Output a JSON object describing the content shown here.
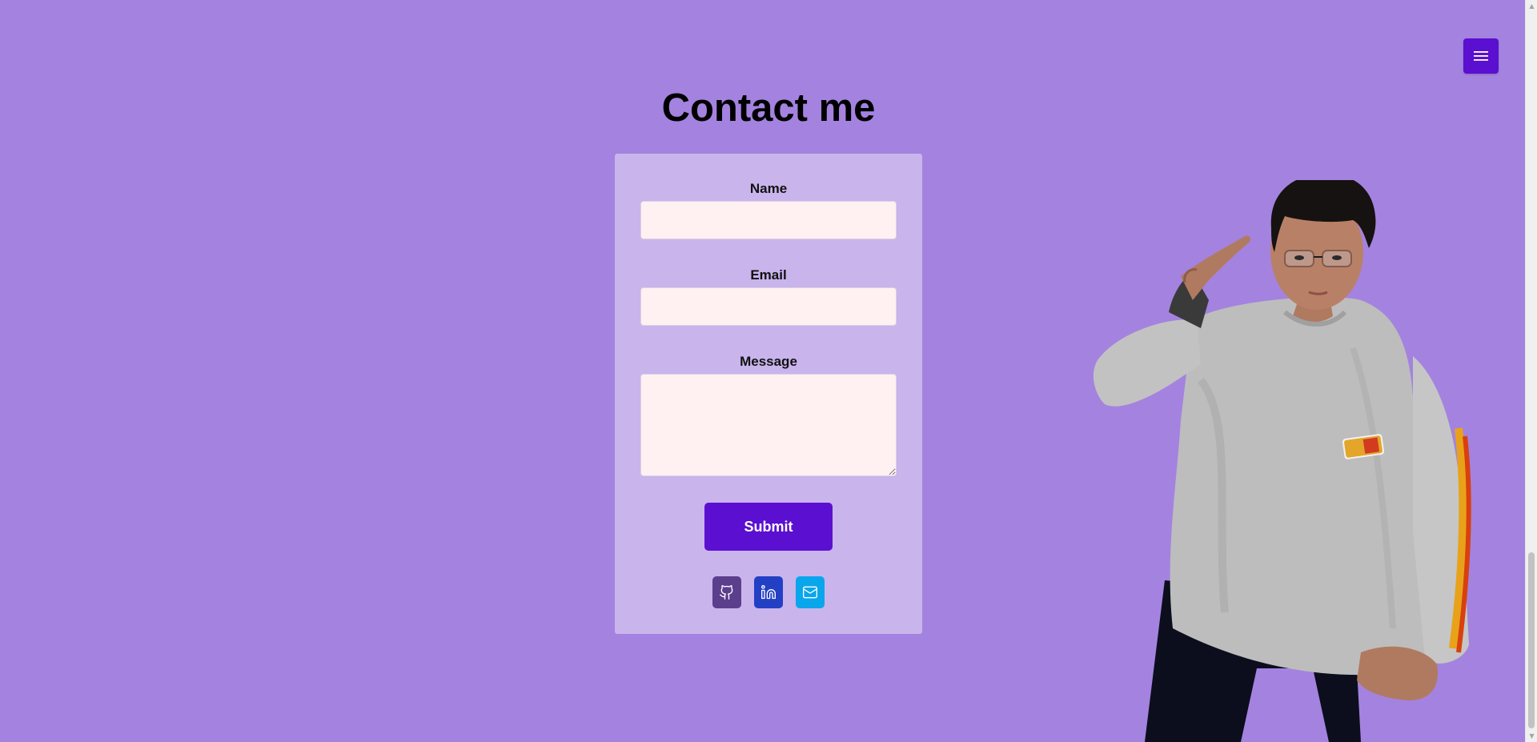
{
  "header": {
    "menu_icon": "hamburger-menu-icon"
  },
  "contact": {
    "title": "Contact me",
    "name_label": "Name",
    "name_value": "",
    "email_label": "Email",
    "email_value": "",
    "message_label": "Message",
    "message_value": "",
    "submit_label": "Submit"
  },
  "socials": [
    {
      "icon": "github-icon",
      "color": "#5b3e8c"
    },
    {
      "icon": "linkedin-icon",
      "color": "#2340c4"
    },
    {
      "icon": "mail-icon",
      "color": "#0aa6ec"
    }
  ],
  "colors": {
    "background": "#a383df",
    "card": "#c9b4ec",
    "accent": "#5b0fd1",
    "input_bg": "#fff0f2"
  }
}
